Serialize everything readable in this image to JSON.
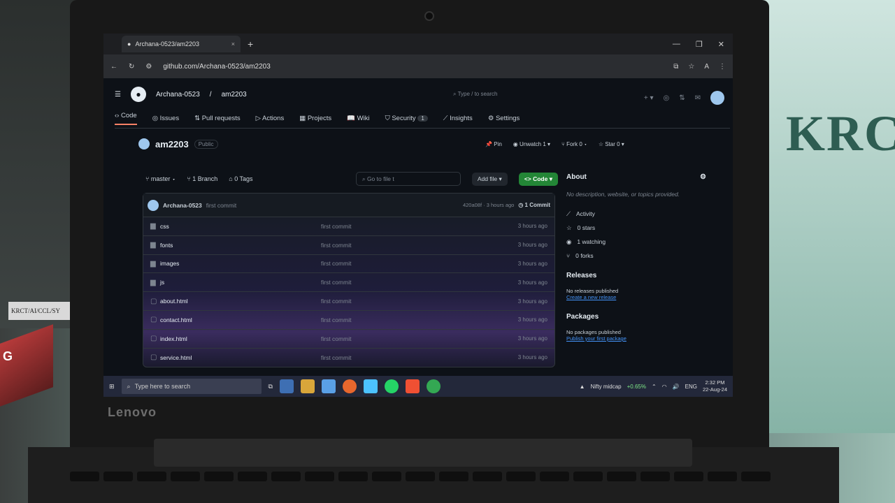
{
  "photo": {
    "shelf_label": "KRCT/AI/CCL/SY",
    "book_text": "G",
    "sign_text": "KRC",
    "laptop_brand": "Lenovo"
  },
  "browser": {
    "tab_title": "Archana-0523/am2203",
    "tab_close": "×",
    "new_tab": "+",
    "url": "github.com/Archana-0523/am2203",
    "profile_initial": "A"
  },
  "github": {
    "owner": "Archana-0523",
    "repo": "am2203",
    "search_placeholder": "Type / to search",
    "nav": [
      {
        "label": "Code"
      },
      {
        "label": "Issues"
      },
      {
        "label": "Pull requests"
      },
      {
        "label": "Actions"
      },
      {
        "label": "Projects"
      },
      {
        "label": "Wiki"
      },
      {
        "label": "Security",
        "count": "1"
      },
      {
        "label": "Insights"
      },
      {
        "label": "Settings"
      }
    ],
    "repo_name": "am2203",
    "visibility": "Public",
    "pin_label": "Pin",
    "watch_label": "Unwatch",
    "watch_count": "1",
    "fork_label": "Fork",
    "fork_count": "0",
    "star_label": "Star",
    "star_count": "0",
    "branch": "master",
    "branch_count": "1 Branch",
    "tags_count": "0 Tags",
    "goto_placeholder": "Go to file",
    "goto_key": "t",
    "add_file": "Add file",
    "code_button": "<> Code",
    "commit_author": "Archana-0523",
    "commit_message": "first commit",
    "commit_meta": "420a08f · 3 hours ago",
    "commit_count": "1 Commit",
    "files": [
      {
        "name": "css",
        "type": "folder",
        "message": "first commit",
        "time": "3 hours ago"
      },
      {
        "name": "fonts",
        "type": "folder",
        "message": "first commit",
        "time": "3 hours ago"
      },
      {
        "name": "images",
        "type": "folder",
        "message": "first commit",
        "time": "3 hours ago"
      },
      {
        "name": "js",
        "type": "folder",
        "message": "first commit",
        "time": "3 hours ago"
      },
      {
        "name": "about.html",
        "type": "file",
        "message": "first commit",
        "time": "3 hours ago"
      },
      {
        "name": "contact.html",
        "type": "file",
        "message": "first commit",
        "time": "3 hours ago"
      },
      {
        "name": "index.html",
        "type": "file",
        "message": "first commit",
        "time": "3 hours ago"
      },
      {
        "name": "service.html",
        "type": "file",
        "message": "first commit",
        "time": "3 hours ago"
      }
    ],
    "about": {
      "title": "About",
      "description": "No description, website, or topics provided.",
      "activity": "Activity",
      "stars": "0 stars",
      "watching": "1 watching",
      "forks": "0 forks",
      "releases_title": "Releases",
      "releases_text": "No releases published",
      "releases_link": "Create a new release",
      "packages_title": "Packages",
      "packages_text": "No packages published",
      "packages_link": "Publish your first package"
    }
  },
  "taskbar": {
    "search_placeholder": "Type here to search",
    "ticker_label": "Nifty midcap",
    "ticker_value": "+0.65%",
    "lang": "ENG",
    "time": "2:32 PM",
    "date": "22-Aug-24"
  }
}
